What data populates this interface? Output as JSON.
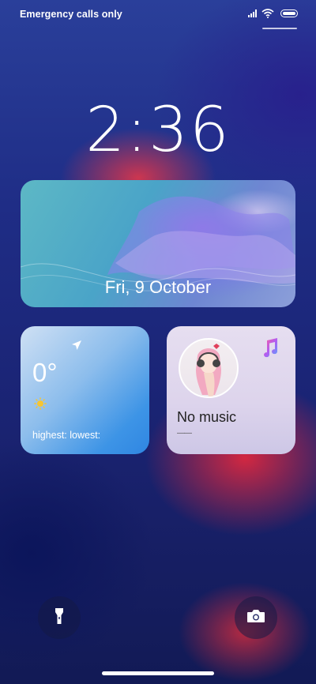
{
  "status_bar": {
    "carrier_text": "Emergency calls only",
    "icons": [
      "signal-icon",
      "wifi-icon",
      "battery-icon"
    ]
  },
  "clock": {
    "time": "2:36"
  },
  "date_widget": {
    "date": "Fri, 9 October"
  },
  "weather_widget": {
    "temperature": "0°",
    "high_low": "highest: lowest:",
    "icons": [
      "location-icon",
      "sun-icon"
    ]
  },
  "music_widget": {
    "title": "No music",
    "artist": "——",
    "icons": [
      "music-note-icon"
    ]
  },
  "bottom_controls": {
    "left": "flashlight-icon",
    "right": "camera-icon"
  },
  "colors": {
    "background": "#1f2d86",
    "accent_red": "#e63446",
    "weather_blue": "#2f86e2",
    "music_bg": "#e6def0"
  }
}
